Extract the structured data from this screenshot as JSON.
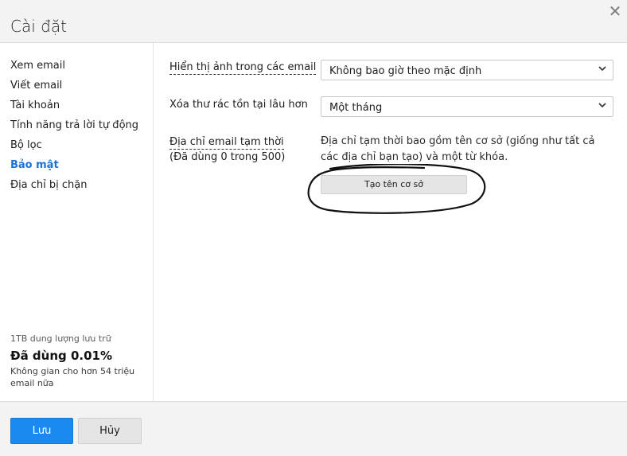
{
  "dialog": {
    "title": "Cài đặt",
    "close_icon": "close-icon"
  },
  "sidebar": {
    "items": [
      {
        "label": "Xem email",
        "active": false
      },
      {
        "label": "Viết email",
        "active": false
      },
      {
        "label": "Tài khoản",
        "active": false
      },
      {
        "label": "Tính năng trả lời tự động",
        "active": false
      },
      {
        "label": "Bộ lọc",
        "active": false
      },
      {
        "label": "Bảo mật",
        "active": true
      },
      {
        "label": "Địa chỉ bị chặn",
        "active": false
      }
    ],
    "storage": {
      "capacity": "1TB dung lượng lưu trữ",
      "used": "Đã dùng 0.01%",
      "remaining": "Không gian cho hơn 54 triệu email nữa"
    }
  },
  "settings": {
    "show_images": {
      "label": "Hiển thị ảnh trong các email",
      "value": "Không bao giờ theo mặc định"
    },
    "delete_junk": {
      "label": "Xóa thư rác tồn tại lâu hơn",
      "value": "Một tháng"
    },
    "temp_email": {
      "label": "Địa chỉ email tạm thời",
      "usage": "(Đã dùng 0 trong 500)",
      "description": "Địa chỉ tạm thời bao gồm tên cơ sở (giống như tất cả các địa chỉ bạn tạo) và một từ khóa.",
      "button": "Tạo tên cơ sở"
    }
  },
  "footer": {
    "save": "Lưu",
    "cancel": "Hủy"
  },
  "colors": {
    "accent": "#1b8af0",
    "active_nav": "#1a73d9"
  }
}
